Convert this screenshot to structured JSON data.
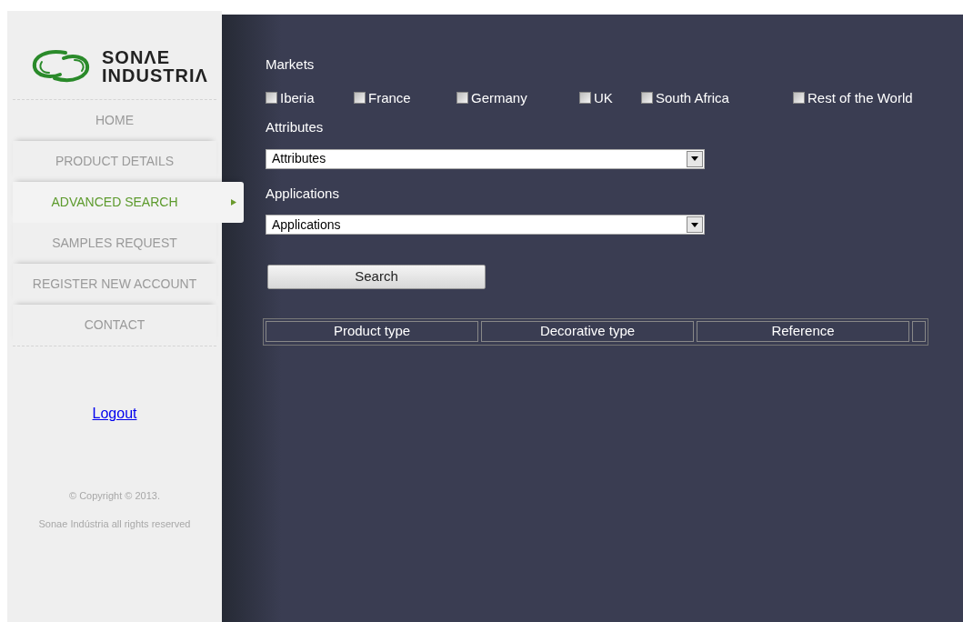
{
  "logo": {
    "line_1": "SONΛE",
    "line_2": "INDUSTRIΛ"
  },
  "sidebar": {
    "items": [
      {
        "label": "HOME",
        "selected": false
      },
      {
        "label": "PRODUCT DETAILS",
        "selected": false
      },
      {
        "label": "ADVANCED SEARCH",
        "selected": true
      },
      {
        "label": "SAMPLES REQUEST",
        "selected": false
      },
      {
        "label": "REGISTER NEW ACCOUNT",
        "selected": false
      },
      {
        "label": "CONTACT",
        "selected": false
      }
    ],
    "logout": "Logout",
    "copyright": "© Copyright © 2013.",
    "rights": "Sonae Indústria all rights reserved"
  },
  "markets": {
    "label": "Markets",
    "options": [
      {
        "label": "Iberia",
        "checked": false
      },
      {
        "label": "France",
        "checked": false
      },
      {
        "label": "Germany",
        "checked": false
      },
      {
        "label": "UK",
        "checked": false
      },
      {
        "label": "South Africa",
        "checked": false
      },
      {
        "label": "Rest of the World",
        "checked": false
      }
    ]
  },
  "attributes": {
    "label": "Attributes",
    "value": "Attributes"
  },
  "applications": {
    "label": "Applications",
    "value": "Applications"
  },
  "search_button": "Search",
  "table": {
    "columns": [
      "Product type",
      "Decorative type",
      "Reference"
    ]
  }
}
